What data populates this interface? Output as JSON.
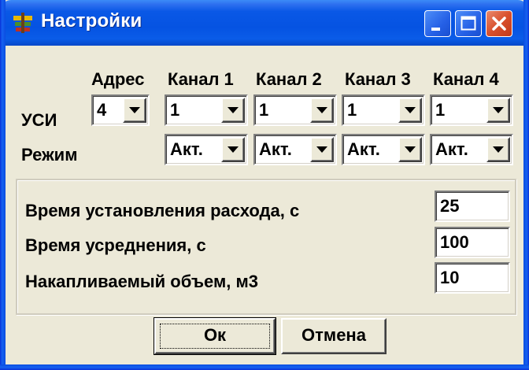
{
  "window": {
    "title": "Настройки",
    "icon": "app-tree-icon",
    "controls": [
      "minimize-icon",
      "maximize-icon",
      "close-icon"
    ]
  },
  "headers": {
    "address": "Адрес",
    "channels": [
      "Канал 1",
      "Канал 2",
      "Канал 3",
      "Канал 4"
    ]
  },
  "rows": {
    "usi_label": "УСИ",
    "mode_label": "Режим",
    "address_value": "4",
    "channel_values": [
      "1",
      "1",
      "1",
      "1"
    ],
    "mode_values": [
      "Акт.",
      "Акт.",
      "Акт.",
      "Акт."
    ]
  },
  "settings": [
    {
      "label": "Время установления расхода, с",
      "value": "25"
    },
    {
      "label": "Время усреднения, с",
      "value": "100"
    },
    {
      "label": "Накапливаемый объем, м3",
      "value": "10"
    }
  ],
  "buttons": {
    "ok": "Ок",
    "cancel": "Отмена"
  },
  "colors": {
    "titlebar": "#0553e2",
    "face": "#ece9d8",
    "close": "#d9502d"
  }
}
